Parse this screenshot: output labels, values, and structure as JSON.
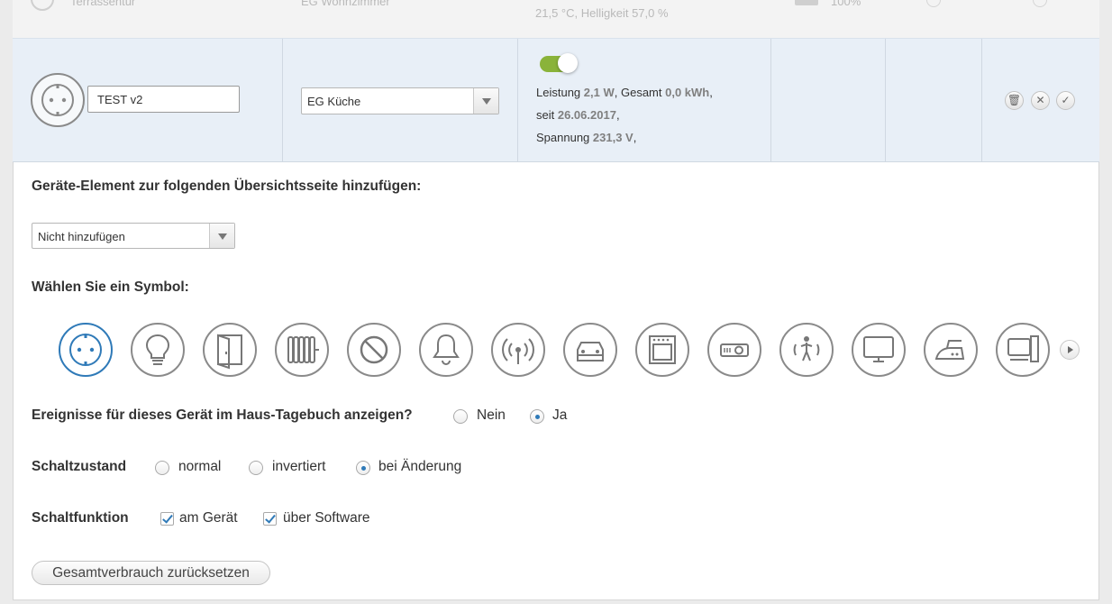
{
  "prev_row": {
    "name": "Terrassentür",
    "room": "EG Wohnzimmer",
    "status": "21,5 °C,  Helligkeit 57,0 %",
    "battery": "100%"
  },
  "edit_row": {
    "device_name": "TEST v2",
    "room_select": "EG Küche",
    "switch_on": true,
    "stats": {
      "leistung_label": "Leistung",
      "leistung_value": "2,1 W",
      "gesamt_label": "Gesamt",
      "gesamt_value": "0,0 kWh",
      "seit_label": "seit",
      "seit_value": "26.06.2017",
      "spannung_label": "Spannung",
      "spannung_value": "231,3 V"
    },
    "actions": {
      "delete": "🗑",
      "cancel": "✕",
      "confirm": "✓"
    }
  },
  "settings": {
    "overview_label": "Geräte-Element zur folgenden Übersichtsseite hinzufügen:",
    "overview_select": "Nicht hinzufügen",
    "symbol_label": "Wählen Sie ein Symbol:",
    "symbols": [
      "socket-icon",
      "bulb-icon",
      "door-icon",
      "radiator-icon",
      "blocked-icon",
      "bell-icon",
      "antenna-icon",
      "car-icon",
      "oven-icon",
      "projector-icon",
      "motion-icon",
      "monitor-icon",
      "iron-icon",
      "computer-icon"
    ],
    "diary_label": "Ereignisse für dieses Gerät im Haus-Tagebuch anzeigen?",
    "diary_no": "Nein",
    "diary_yes": "Ja",
    "schaltzustand_label": "Schaltzustand",
    "schaltzustand_normal": "normal",
    "schaltzustand_invertiert": "invertiert",
    "schaltzustand_aenderung": "bei Änderung",
    "schaltfunktion_label": "Schaltfunktion",
    "schaltfunktion_geraet": "am Gerät",
    "schaltfunktion_software": "über Software",
    "reset_button": "Gesamtverbrauch zurücksetzen"
  },
  "colors": {
    "accent": "#2f7ab8",
    "toggle_on": "#8ab33a",
    "row_highlight": "#e8eff7"
  }
}
